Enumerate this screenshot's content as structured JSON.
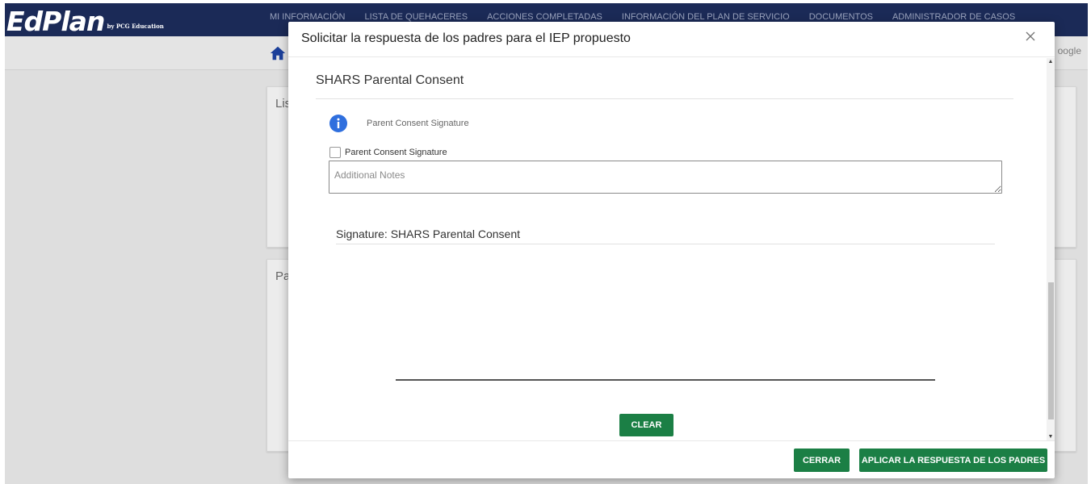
{
  "app": {
    "logo_main": "EdPlan",
    "logo_by": "by PCG Education",
    "nav": [
      "MI INFORMACIÓN",
      "LISTA DE QUEHACERES",
      "ACCIONES COMPLETADAS",
      "INFORMACIÓN DEL PLAN DE SERVICIO",
      "DOCUMENTOS",
      "ADMINISTRADOR DE CASOS"
    ],
    "google_partial": "oogle",
    "card1_partial_title": "Lis",
    "card2_partial_title": "Pa"
  },
  "modal": {
    "title": "Solicitar la respuesta de los padres para el IEP propuesto",
    "section_title": "SHARS Parental Consent",
    "info_text": "Parent Consent Signature",
    "checkbox_label": "Parent Consent Signature",
    "notes_placeholder": "Additional Notes",
    "signature_title": "Signature: SHARS Parental Consent",
    "clear_label": "CLEAR",
    "cerrar_label": "CERRAR",
    "aplicar_label": "APLICAR LA RESPUESTA DE LOS PADRES"
  },
  "colors": {
    "brand_navy": "#1b2a57",
    "action_green": "#1b7f45",
    "info_blue": "#2f6fde"
  }
}
